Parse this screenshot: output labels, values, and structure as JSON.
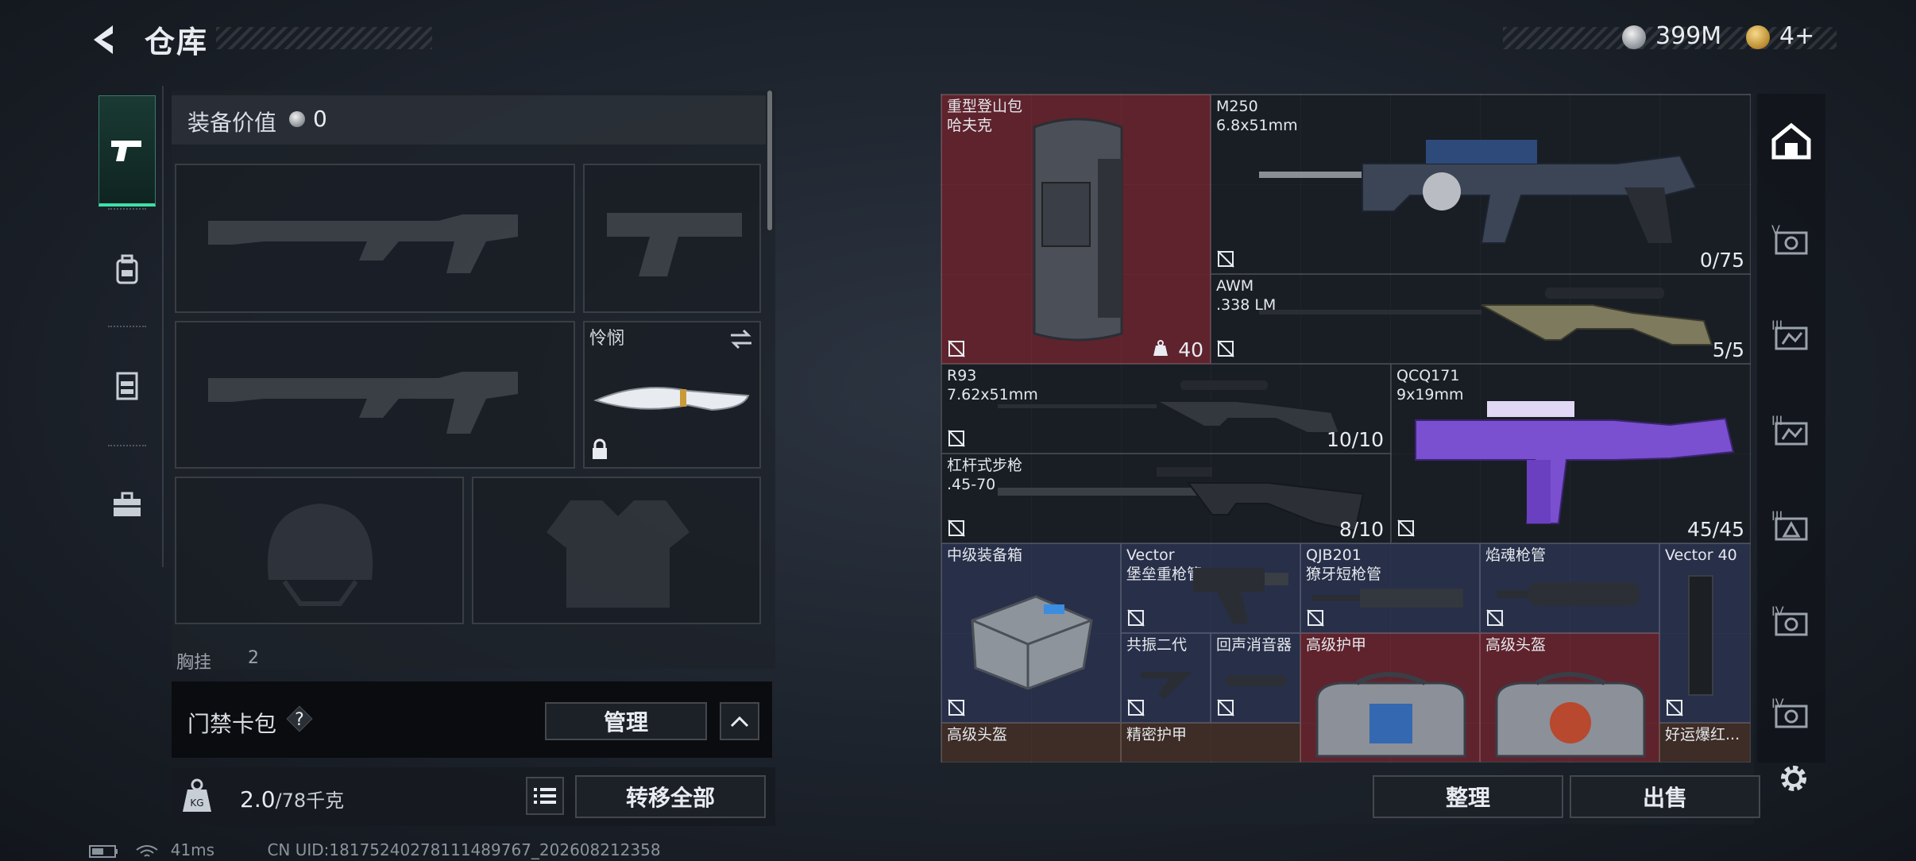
{
  "header": {
    "title": "仓库",
    "currency_silver": "399M",
    "currency_gold": "4+"
  },
  "left": {
    "tabs": [
      {
        "icon": "pistol-icon",
        "active": true
      },
      {
        "icon": "backpack-icon",
        "active": false
      },
      {
        "icon": "vest-icon",
        "active": false
      },
      {
        "icon": "briefcase-icon",
        "active": false
      }
    ],
    "equip_label": "装备价值",
    "equip_value": "0",
    "melee_name": "怜悯",
    "chest_label": "胸挂",
    "chest_count": "2",
    "keycard_label": "门禁卡包",
    "keycard_help": "?",
    "manage_btn": "管理",
    "weight_value": "2.0",
    "weight_unit": "/78千克",
    "transfer_btn": "转移全部"
  },
  "grid": {
    "items": [
      {
        "name": "重型登山包\n哈夫克",
        "count": "40",
        "color": "red"
      },
      {
        "name": "M250\n6.8x51mm",
        "count": "0/75",
        "color": "dark"
      },
      {
        "name": "AWM\n.338 LM",
        "count": "5/5",
        "color": "dark"
      },
      {
        "name": "R93\n7.62x51mm",
        "count": "10/10",
        "color": "dark"
      },
      {
        "name": "QCQ171\n9x19mm",
        "count": "45/45",
        "color": "dark"
      },
      {
        "name": "杠杆式步枪\n.45-70",
        "count": "8/10",
        "color": "dark"
      },
      {
        "name": "中级装备箱",
        "count": "",
        "color": "blue"
      },
      {
        "name": "Vector\n堡垒重枪管",
        "count": "",
        "color": "blue"
      },
      {
        "name": "QJB201\n獠牙短枪管",
        "count": "",
        "color": "blue"
      },
      {
        "name": "焰魂枪管",
        "count": "",
        "color": "blue"
      },
      {
        "name": "Vector 40",
        "count": "",
        "color": "blue"
      },
      {
        "name": "共振二代",
        "count": "",
        "color": "blue"
      },
      {
        "name": "回声消音器",
        "count": "",
        "color": "blue"
      },
      {
        "name": "高级护甲",
        "count": "",
        "color": "red"
      },
      {
        "name": "高级头盔",
        "count": "",
        "color": "red"
      },
      {
        "name": "高级头盔",
        "count": "",
        "color": "brown"
      },
      {
        "name": "精密护甲",
        "count": "",
        "color": "brown"
      },
      {
        "name": "好运爆红...",
        "count": "",
        "color": "brown"
      }
    ],
    "sort_btn": "整理",
    "sell_btn": "出售"
  },
  "right_tabs": [
    "home-icon",
    "vest-v-icon",
    "vest-iii-icon",
    "vest-iii-icon",
    "box-iii-icon",
    "vest-iv-icon",
    "vest-iv-icon"
  ],
  "status": {
    "ping": "41ms",
    "uid": "CN UID:18175240278111489767_202608212358"
  },
  "colors": {
    "accent": "#3de0a6",
    "red_cell": "#78242e",
    "blue_cell": "#2c3454"
  }
}
